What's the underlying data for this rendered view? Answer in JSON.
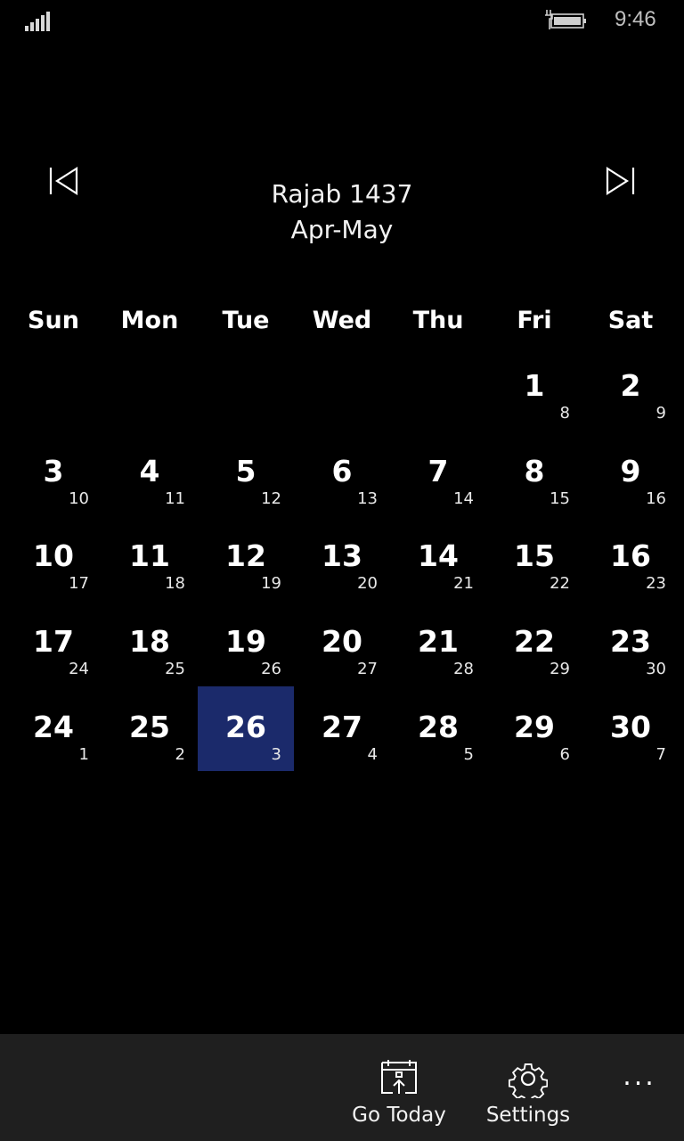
{
  "status_bar": {
    "time": "9:46",
    "signal_icon": "signal-bars-icon",
    "battery_icon": "battery-charging-icon"
  },
  "header": {
    "title": "Rajab 1437",
    "subtitle": "Apr-May",
    "prev_icon": "skip-previous-icon",
    "next_icon": "skip-next-icon"
  },
  "calendar": {
    "weekdays": [
      "Sun",
      "Mon",
      "Tue",
      "Wed",
      "Thu",
      "Fri",
      "Sat"
    ],
    "weeks": [
      [
        null,
        null,
        null,
        null,
        null,
        {
          "g": "1",
          "h": "8"
        },
        {
          "g": "2",
          "h": "9"
        }
      ],
      [
        {
          "g": "3",
          "h": "10"
        },
        {
          "g": "4",
          "h": "11"
        },
        {
          "g": "5",
          "h": "12"
        },
        {
          "g": "6",
          "h": "13"
        },
        {
          "g": "7",
          "h": "14"
        },
        {
          "g": "8",
          "h": "15"
        },
        {
          "g": "9",
          "h": "16"
        }
      ],
      [
        {
          "g": "10",
          "h": "17"
        },
        {
          "g": "11",
          "h": "18"
        },
        {
          "g": "12",
          "h": "19"
        },
        {
          "g": "13",
          "h": "20"
        },
        {
          "g": "14",
          "h": "21"
        },
        {
          "g": "15",
          "h": "22"
        },
        {
          "g": "16",
          "h": "23"
        }
      ],
      [
        {
          "g": "17",
          "h": "24"
        },
        {
          "g": "18",
          "h": "25"
        },
        {
          "g": "19",
          "h": "26"
        },
        {
          "g": "20",
          "h": "27"
        },
        {
          "g": "21",
          "h": "28"
        },
        {
          "g": "22",
          "h": "29"
        },
        {
          "g": "23",
          "h": "30"
        }
      ],
      [
        {
          "g": "24",
          "h": "1"
        },
        {
          "g": "25",
          "h": "2"
        },
        {
          "g": "26",
          "h": "3",
          "today": true
        },
        {
          "g": "27",
          "h": "4"
        },
        {
          "g": "28",
          "h": "5"
        },
        {
          "g": "29",
          "h": "6"
        },
        {
          "g": "30",
          "h": "7"
        }
      ]
    ],
    "today_color": "#1b2a6b"
  },
  "appbar": {
    "go_today": "Go Today",
    "settings": "Settings",
    "more": "..."
  }
}
